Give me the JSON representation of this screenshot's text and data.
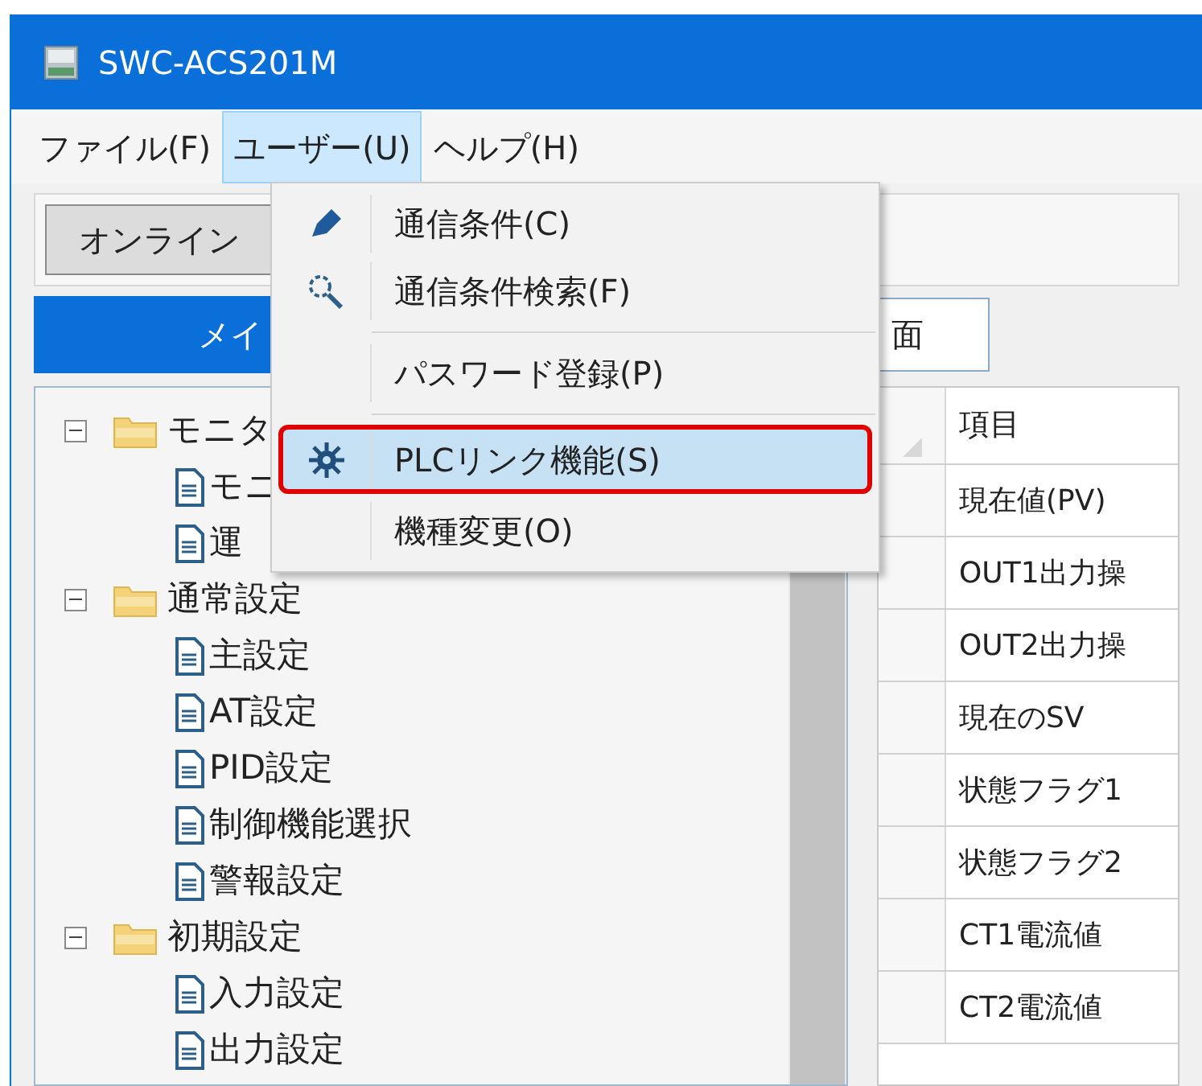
{
  "window": {
    "title": "SWC-ACS201M"
  },
  "menu_bar": [
    {
      "label": "ファイル(F)",
      "selected": false
    },
    {
      "label": "ユーザー(U)",
      "selected": true
    },
    {
      "label": "ヘルプ(H)",
      "selected": false
    }
  ],
  "toolbar": {
    "buttons": [
      "オンライン"
    ]
  },
  "tabs": [
    {
      "label": "メイ",
      "selected": true
    },
    {
      "label": "面",
      "selected": false
    }
  ],
  "tree": [
    {
      "label": "モニタ",
      "expanded": true,
      "children": [
        {
          "label": "モニ"
        },
        {
          "label": "運"
        }
      ]
    },
    {
      "label": "通常設定",
      "expanded": true,
      "children": [
        {
          "label": "主設定"
        },
        {
          "label": "AT設定"
        },
        {
          "label": "PID設定"
        },
        {
          "label": "制御機能選択"
        },
        {
          "label": "警報設定"
        }
      ]
    },
    {
      "label": "初期設定",
      "expanded": true,
      "children": [
        {
          "label": "入力設定"
        },
        {
          "label": "出力設定"
        }
      ]
    }
  ],
  "grid": {
    "columns": [
      "項目"
    ],
    "rows": [
      "現在値(PV)",
      "OUT1出力操",
      "OUT2出力操",
      "現在のSV",
      "状態フラグ1",
      "状態フラグ2",
      "CT1電流値",
      "CT2電流値"
    ]
  },
  "dropdown": {
    "items": [
      {
        "kind": "item",
        "label": "通信条件(C)",
        "selected": false
      },
      {
        "kind": "item",
        "label": "通信条件検索(F)",
        "selected": false
      },
      {
        "kind": "separator"
      },
      {
        "kind": "item",
        "label": "パスワード登録(P)",
        "selected": false
      },
      {
        "kind": "separator"
      },
      {
        "kind": "item",
        "label": "PLCリンク機能(S)",
        "selected": true
      },
      {
        "kind": "item",
        "label": "機種変更(O)",
        "selected": false
      }
    ]
  }
}
